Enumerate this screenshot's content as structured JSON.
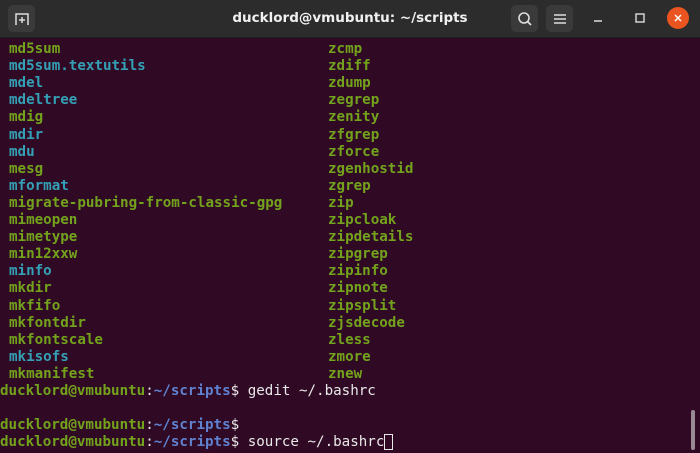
{
  "window": {
    "title": "ducklord@vmubuntu: ~/scripts"
  },
  "icons": {
    "new_tab": "new-tab-icon",
    "search": "search-icon",
    "menu": "hamburger-menu-icon",
    "minimize": "minimize-icon",
    "maximize": "maximize-icon",
    "close": "close-icon"
  },
  "colors": {
    "background": "#300a24",
    "executable": "#73a31c",
    "symlink": "#34a0b5",
    "prompt_user": "#73a31c",
    "prompt_path": "#5f82d0",
    "close_button": "#e95420"
  },
  "listing": {
    "left": [
      {
        "name": "md5sum",
        "kind": "exec"
      },
      {
        "name": "md5sum.textutils",
        "kind": "link"
      },
      {
        "name": "mdel",
        "kind": "link"
      },
      {
        "name": "mdeltree",
        "kind": "link"
      },
      {
        "name": "mdig",
        "kind": "exec"
      },
      {
        "name": "mdir",
        "kind": "link"
      },
      {
        "name": "mdu",
        "kind": "link"
      },
      {
        "name": "mesg",
        "kind": "exec"
      },
      {
        "name": "mformat",
        "kind": "link"
      },
      {
        "name": "migrate-pubring-from-classic-gpg",
        "kind": "exec"
      },
      {
        "name": "mimeopen",
        "kind": "exec"
      },
      {
        "name": "mimetype",
        "kind": "exec"
      },
      {
        "name": "min12xxw",
        "kind": "exec"
      },
      {
        "name": "minfo",
        "kind": "link"
      },
      {
        "name": "mkdir",
        "kind": "exec"
      },
      {
        "name": "mkfifo",
        "kind": "exec"
      },
      {
        "name": "mkfontdir",
        "kind": "exec"
      },
      {
        "name": "mkfontscale",
        "kind": "exec"
      },
      {
        "name": "mkisofs",
        "kind": "link"
      },
      {
        "name": "mkmanifest",
        "kind": "exec"
      }
    ],
    "right": [
      {
        "name": "zcmp",
        "kind": "exec"
      },
      {
        "name": "zdiff",
        "kind": "exec"
      },
      {
        "name": "zdump",
        "kind": "exec"
      },
      {
        "name": "zegrep",
        "kind": "exec"
      },
      {
        "name": "zenity",
        "kind": "exec"
      },
      {
        "name": "zfgrep",
        "kind": "exec"
      },
      {
        "name": "zforce",
        "kind": "exec"
      },
      {
        "name": "zgenhostid",
        "kind": "exec"
      },
      {
        "name": "zgrep",
        "kind": "exec"
      },
      {
        "name": "zip",
        "kind": "exec"
      },
      {
        "name": "zipcloak",
        "kind": "exec"
      },
      {
        "name": "zipdetails",
        "kind": "exec"
      },
      {
        "name": "zipgrep",
        "kind": "exec"
      },
      {
        "name": "zipinfo",
        "kind": "exec"
      },
      {
        "name": "zipnote",
        "kind": "exec"
      },
      {
        "name": "zipsplit",
        "kind": "exec"
      },
      {
        "name": "zjsdecode",
        "kind": "exec"
      },
      {
        "name": "zless",
        "kind": "exec"
      },
      {
        "name": "zmore",
        "kind": "exec"
      },
      {
        "name": "znew",
        "kind": "exec"
      }
    ]
  },
  "prompts": [
    {
      "user": "ducklord@vmubuntu",
      "sep": ":",
      "path": "~/scripts",
      "sigil": "$",
      "command": " gedit ~/.bashrc"
    },
    {
      "user": "",
      "sep": "",
      "path": "",
      "sigil": "",
      "command": ""
    },
    {
      "user": "ducklord@vmubuntu",
      "sep": ":",
      "path": "~/scripts",
      "sigil": "$",
      "command": ""
    },
    {
      "user": "ducklord@vmubuntu",
      "sep": ":",
      "path": "~/scripts",
      "sigil": "$",
      "command": " source ~/.bashrc"
    }
  ]
}
